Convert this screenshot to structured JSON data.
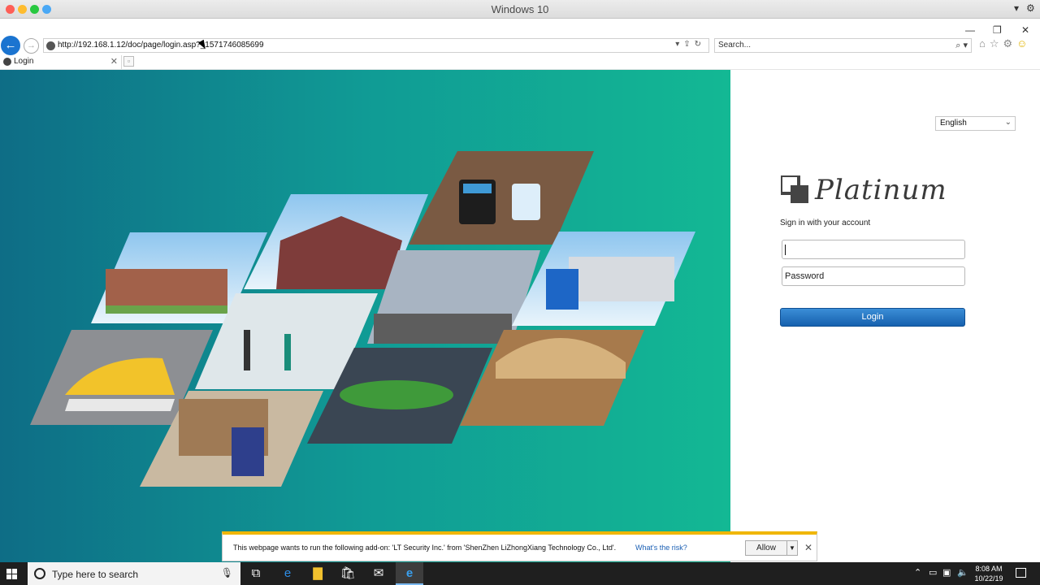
{
  "os_window": {
    "title": "Windows 10",
    "colors": {
      "close": "#fe5f57",
      "minimize": "#febc2e",
      "zoom": "#28c840",
      "extra": "#4aa8f5"
    }
  },
  "browser": {
    "url": "http://192.168.1.12/doc/page/login.asp?_1571746085699",
    "search_placeholder": "Search...",
    "tab_label": "Login",
    "icons": [
      "back-icon",
      "forward-icon",
      "home-icon",
      "favorites-star-icon",
      "settings-gear-icon",
      "feedback-smiley-icon"
    ]
  },
  "login_page": {
    "language": "English",
    "brand": "Platinum",
    "signin_text": "Sign in with your account",
    "username_value": "",
    "password_placeholder": "Password",
    "login_button": "Login",
    "hero_colors": {
      "start": "#0e6d86",
      "end": "#13b894"
    },
    "button_color": "#1a68b5"
  },
  "notification": {
    "message": "This webpage wants to run the following add-on: 'LT Security Inc.' from 'ShenZhen LiZhongXiang Technology Co., Ltd'.",
    "link": "What's the risk?",
    "allow": "Allow",
    "accent": "#f0b600"
  },
  "taskbar": {
    "search_placeholder": "Type here to search",
    "time": "8:08 AM",
    "date": "10/22/19",
    "pinned": [
      "task-view-icon",
      "edge-icon",
      "file-explorer-icon",
      "store-icon",
      "mail-icon",
      "internet-explorer-icon"
    ]
  }
}
